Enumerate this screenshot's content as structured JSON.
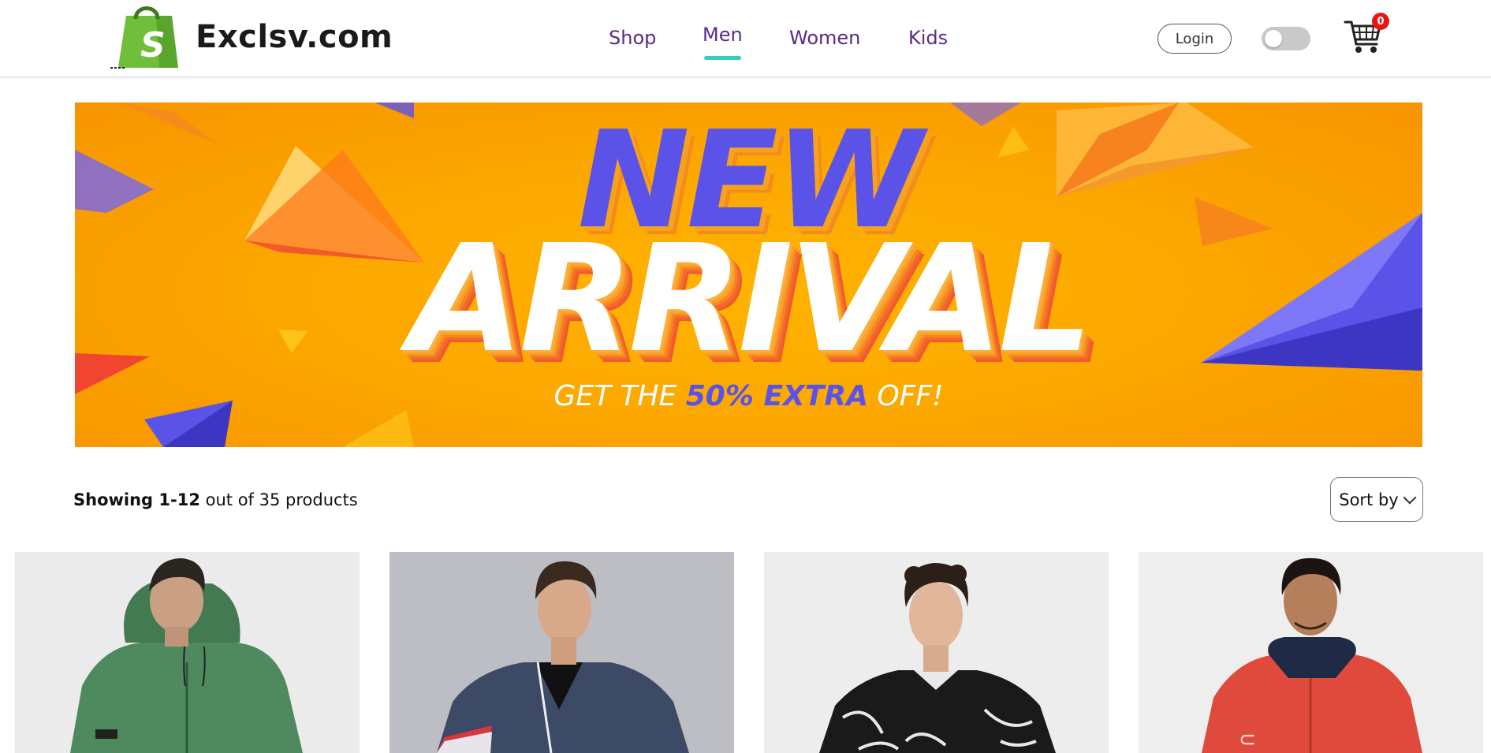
{
  "header": {
    "brand": "Exclsv.com",
    "nav": [
      {
        "label": "Shop",
        "active": false
      },
      {
        "label": "Men",
        "active": true
      },
      {
        "label": "Women",
        "active": false
      },
      {
        "label": "Kids",
        "active": false
      }
    ],
    "login_label": "Login",
    "theme_toggle_on": false,
    "cart_count": "0",
    "colors": {
      "nav_text": "#5a2a8c",
      "active_underline": "#3cc9c0",
      "badge": "#e81515",
      "logo_green": "#5aa52e"
    }
  },
  "banner": {
    "line1": "NEW",
    "line2": "ARRIVAL",
    "offer_prefix": "GET THE ",
    "offer_highlight": "50% EXTRA",
    "offer_suffix": " OFF!",
    "colors": {
      "background": "#fca800",
      "accent": "#5b53e8"
    }
  },
  "results": {
    "showing_strong": "Showing 1-12",
    "showing_rest": " out of 35 products",
    "sort_label": "Sort by"
  },
  "products": [
    {
      "image": "man-in-green-hooded-jacket",
      "bg": "#ebebeb"
    },
    {
      "image": "man-in-navy-colorblock-bomber-jacket",
      "bg": "#bdbdc4"
    },
    {
      "image": "man-in-black-white-marble-print-jacket",
      "bg": "#ededed"
    },
    {
      "image": "man-in-red-hooded-windcheater",
      "bg": "#eeeeee"
    }
  ]
}
